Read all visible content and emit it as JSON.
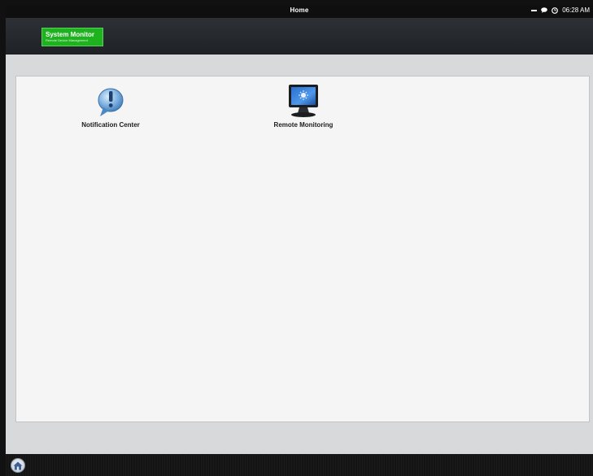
{
  "titlebar": {
    "title": "Home",
    "time": "06:28 AM"
  },
  "logo": {
    "name": "System Monitor",
    "subtitle": "Remote Device Management"
  },
  "apps": [
    {
      "label": "Notification Center",
      "icon": "notification-bubble-icon"
    },
    {
      "label": "Remote Monitoring",
      "icon": "monitor-icon"
    }
  ],
  "dock": {
    "home_icon": "home-icon"
  },
  "colors": {
    "brand_green": "#1fb21f",
    "header_dark": "#23262b",
    "workspace_bg": "#d8d9db",
    "panel_bg": "#f5f5f5"
  }
}
